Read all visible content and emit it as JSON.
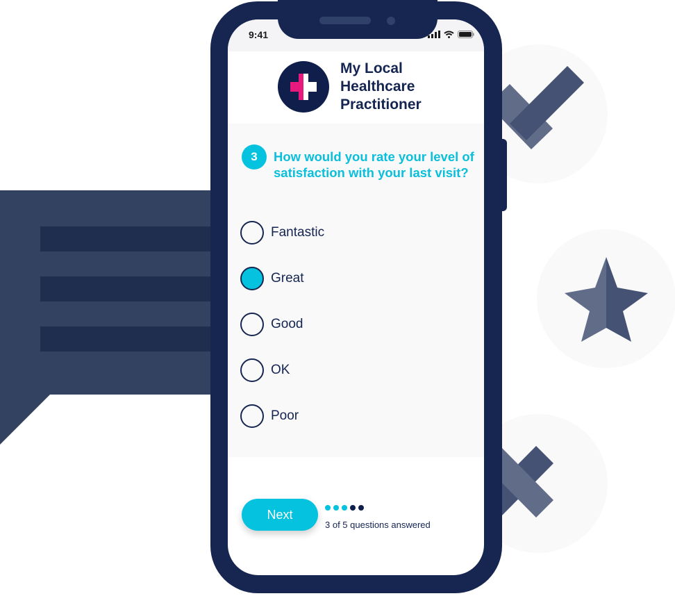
{
  "status_bar": {
    "time": "9:41",
    "icons": [
      "cellular-signal-icon",
      "wifi-icon",
      "battery-icon"
    ]
  },
  "header": {
    "logo_icon": "medical-cross-icon",
    "brand_line1": "My Local",
    "brand_line2": "Healthcare",
    "brand_line3": "Practitioner"
  },
  "question": {
    "number": "3",
    "text": "How would you rate your level of satisfaction with your last visit?"
  },
  "options": [
    {
      "label": "Fantastic",
      "selected": false
    },
    {
      "label": "Great",
      "selected": true
    },
    {
      "label": "Good",
      "selected": false
    },
    {
      "label": "OK",
      "selected": false
    },
    {
      "label": "Poor",
      "selected": false
    }
  ],
  "footer": {
    "next_label": "Next",
    "progress": {
      "answered": 3,
      "total": 5
    },
    "progress_text": "3 of 5 questions answered"
  },
  "decorations": [
    "chat-bubble-icon",
    "checkmark-icon",
    "star-icon",
    "x-icon"
  ],
  "colors": {
    "accent": "#05c2de",
    "navy": "#162650",
    "deco_light": "#606c88",
    "deco_dark": "#465273",
    "logo_pink": "#e6197c"
  }
}
